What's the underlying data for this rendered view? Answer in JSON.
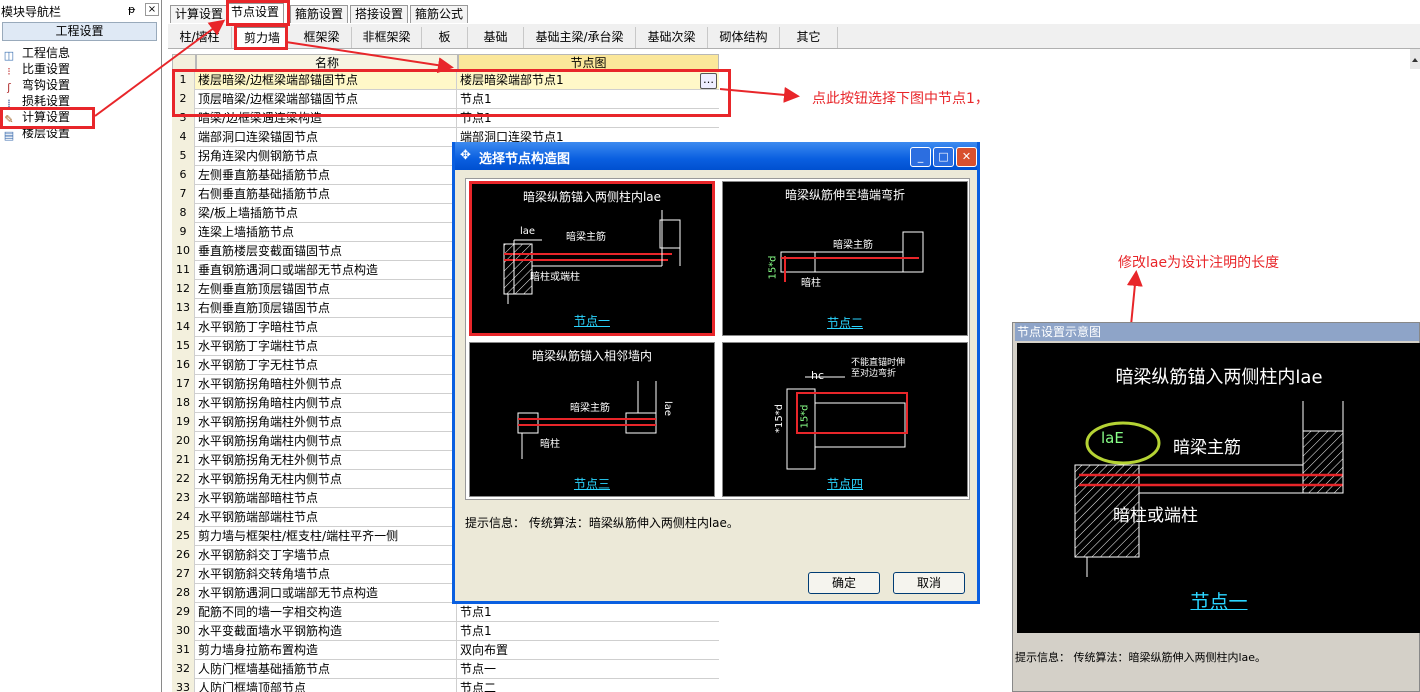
{
  "nav": {
    "title": "模块导航栏",
    "pin": "ᵽ",
    "close": "×",
    "section": "工程设置",
    "items": [
      {
        "label": "工程信息",
        "icon": "project-info-icon",
        "glyph": "◫"
      },
      {
        "label": "比重设置",
        "icon": "weight-icon",
        "glyph": "⁝"
      },
      {
        "label": "弯钩设置",
        "icon": "hook-icon",
        "glyph": "ʃ"
      },
      {
        "label": "损耗设置",
        "icon": "loss-icon",
        "glyph": "⁞"
      },
      {
        "label": "计算设置",
        "icon": "calc-settings-icon",
        "glyph": "✎"
      },
      {
        "label": "楼层设置",
        "icon": "floor-icon",
        "glyph": "▤"
      }
    ]
  },
  "tabs": [
    "计算设置",
    "节点设置",
    "箍筋设置",
    "搭接设置",
    "箍筋公式"
  ],
  "subtabs": [
    "柱/墙柱",
    "剪力墙",
    "框架梁",
    "非框架梁",
    "板",
    "基础",
    "基础主梁/承台梁",
    "基础次梁",
    "砌体结构",
    "其它"
  ],
  "grid": {
    "col_name": "名称",
    "col_node": "节点图",
    "rows": [
      {
        "n": "1",
        "name": "楼层暗梁/边框梁端部锚固节点",
        "value": "楼层暗梁端部节点1"
      },
      {
        "n": "2",
        "name": "顶层暗梁/边框梁端部锚固节点",
        "value": "节点1"
      },
      {
        "n": "3",
        "name": "暗梁/边框梁遇连梁构造",
        "value": "节点1"
      },
      {
        "n": "4",
        "name": "端部洞口连梁锚固节点",
        "value": "端部洞口连梁节点1"
      },
      {
        "n": "5",
        "name": "拐角连梁内侧钢筋节点",
        "value": ""
      },
      {
        "n": "6",
        "name": "左侧垂直筋基础插筋节点",
        "value": ""
      },
      {
        "n": "7",
        "name": "右侧垂直筋基础插筋节点",
        "value": ""
      },
      {
        "n": "8",
        "name": "梁/板上墙插筋节点",
        "value": ""
      },
      {
        "n": "9",
        "name": "连梁上墙插筋节点",
        "value": ""
      },
      {
        "n": "10",
        "name": "垂直筋楼层变截面锚固节点",
        "value": ""
      },
      {
        "n": "11",
        "name": "垂直钢筋遇洞口或端部无节点构造",
        "value": ""
      },
      {
        "n": "12",
        "name": "左侧垂直筋顶层锚固节点",
        "value": ""
      },
      {
        "n": "13",
        "name": "右侧垂直筋顶层锚固节点",
        "value": ""
      },
      {
        "n": "14",
        "name": "水平钢筋丁字暗柱节点",
        "value": ""
      },
      {
        "n": "15",
        "name": "水平钢筋丁字端柱节点",
        "value": ""
      },
      {
        "n": "16",
        "name": "水平钢筋丁字无柱节点",
        "value": ""
      },
      {
        "n": "17",
        "name": "水平钢筋拐角暗柱外侧节点",
        "value": ""
      },
      {
        "n": "18",
        "name": "水平钢筋拐角暗柱内侧节点",
        "value": ""
      },
      {
        "n": "19",
        "name": "水平钢筋拐角端柱外侧节点",
        "value": ""
      },
      {
        "n": "20",
        "name": "水平钢筋拐角端柱内侧节点",
        "value": ""
      },
      {
        "n": "21",
        "name": "水平钢筋拐角无柱外侧节点",
        "value": ""
      },
      {
        "n": "22",
        "name": "水平钢筋拐角无柱内侧节点",
        "value": ""
      },
      {
        "n": "23",
        "name": "水平钢筋端部暗柱节点",
        "value": ""
      },
      {
        "n": "24",
        "name": "水平钢筋端部端柱节点",
        "value": ""
      },
      {
        "n": "25",
        "name": "剪力墙与框架柱/框支柱/端柱平齐一侧",
        "value": ""
      },
      {
        "n": "26",
        "name": "水平钢筋斜交丁字墙节点",
        "value": ""
      },
      {
        "n": "27",
        "name": "水平钢筋斜交转角墙节点",
        "value": ""
      },
      {
        "n": "28",
        "name": "水平钢筋遇洞口或端部无节点构造",
        "value": ""
      },
      {
        "n": "29",
        "name": "配筋不同的墙一字相交构造",
        "value": "节点1"
      },
      {
        "n": "30",
        "name": "水平变截面墙水平钢筋构造",
        "value": "节点1"
      },
      {
        "n": "31",
        "name": "剪力墙身拉筋布置构造",
        "value": "双向布置"
      },
      {
        "n": "32",
        "name": "人防门框墙基础插筋节点",
        "value": "节点一"
      },
      {
        "n": "33",
        "name": "人防门框墙顶部节点",
        "value": "节点二"
      }
    ],
    "ellipsis": "…"
  },
  "annotations": {
    "click_hint": "点此按钮选择下图中节点1，",
    "modify_hint": "修改lae为设计注明的长度"
  },
  "dialog": {
    "title": "选择节点构造图",
    "min": "_",
    "max": "□",
    "close": "✕",
    "cells": [
      {
        "title": "暗梁纵筋锚入两侧柱内lae",
        "link": "节点一",
        "labels": {
          "lae": "lae",
          "main": "暗梁主筋",
          "col": "暗柱或端柱"
        }
      },
      {
        "title": "暗梁纵筋伸至墙端弯折",
        "link": "节点二",
        "labels": {
          "main": "暗梁主筋",
          "col": "暗柱",
          "d": "15*d"
        }
      },
      {
        "title": "暗梁纵筋锚入相邻墙内",
        "link": "节点三",
        "labels": {
          "main": "暗梁主筋",
          "col": "暗柱",
          "lae": "lae"
        }
      },
      {
        "title": "",
        "link": "节点四",
        "labels": {
          "note1": "不能直锚时伸",
          "note2": "至对边弯折",
          "hc": "hc",
          "d1": "*15*d",
          "d2": "15*d"
        }
      }
    ],
    "hint": "提示信息：  传统算法：暗梁纵筋伸入两侧柱内lae。",
    "ok": "确定",
    "cancel": "取消"
  },
  "preview": {
    "title": "节点设置示意图",
    "heading": "暗梁纵筋锚入两侧柱内lae",
    "lae": "laE",
    "main": "暗梁主筋",
    "col": "暗柱或端柱",
    "link": "节点一",
    "hint": "提示信息：  传统算法：暗梁纵筋伸入两侧柱内lae。"
  },
  "colors": {
    "accent_red": "#e8262a",
    "title_blue": "#0a5fe0",
    "link_cyan": "#2bd5ff",
    "highlight_green": "#b5d334"
  }
}
